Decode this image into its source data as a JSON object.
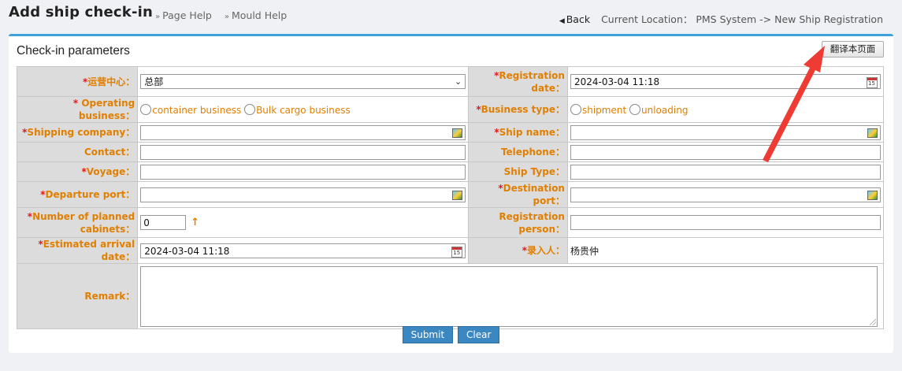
{
  "header": {
    "title": "Add ship check-in",
    "page_help": "Page Help",
    "mould_help": "Mould Help",
    "back_label": "Back",
    "location_label": "Current Location：",
    "location_path": "PMS System -> New Ship Registration"
  },
  "panel": {
    "title": "Check-in parameters",
    "translate_button": "翻译本页面"
  },
  "form": {
    "operation_center": {
      "label": "运营中心：",
      "value": "总部"
    },
    "registration_date": {
      "label": "Registration date：",
      "value": "2024-03-04 11:18"
    },
    "operating_business": {
      "label": "Operating business：",
      "options": [
        "container business",
        "Bulk cargo business"
      ]
    },
    "business_type": {
      "label": "Business type：",
      "options": [
        "shipment",
        "unloading"
      ]
    },
    "shipping_company": {
      "label": "Shipping company：",
      "value": ""
    },
    "ship_name": {
      "label": "Ship name：",
      "value": ""
    },
    "contact": {
      "label": "Contact：",
      "value": ""
    },
    "telephone": {
      "label": "Telephone：",
      "value": ""
    },
    "voyage": {
      "label": "Voyage：",
      "value": ""
    },
    "ship_type": {
      "label": "Ship Type：",
      "value": ""
    },
    "departure_port": {
      "label": "Departure port：",
      "value": ""
    },
    "destination_port": {
      "label": "Destination port：",
      "value": ""
    },
    "planned_cabinets": {
      "label": "Number of planned cabinets：",
      "value": "0"
    },
    "registration_person": {
      "label": "Registration person：",
      "value": ""
    },
    "estimated_arrival": {
      "label": "Estimated arrival date：",
      "value": "2024-03-04 11:18"
    },
    "entered_by": {
      "label": "录入人：",
      "value": "杨贵仲"
    },
    "remark": {
      "label": "Remark：",
      "value": ""
    }
  },
  "actions": {
    "submit": "Submit",
    "clear": "Clear"
  },
  "colors": {
    "accent": "#3da2dc",
    "label_orange": "#e07f00",
    "required_red": "#e0191a",
    "button_blue": "#3b87c1",
    "annotation_red": "#ee3b33"
  }
}
